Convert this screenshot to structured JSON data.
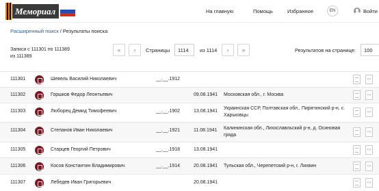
{
  "header": {
    "logo_text": "Мемориал",
    "nav": {
      "home": "На главную",
      "help": "Помощь",
      "favorites": "Избранное",
      "lang": "EN",
      "login": "Войти"
    }
  },
  "breadcrumb": {
    "advanced": "Расширенный поиск",
    "sep": "/",
    "current": "Результаты поиска"
  },
  "pager": {
    "records_line1": "Записи с 111301 по 111389",
    "records_line2": "из 111389",
    "first": "«",
    "prev": "‹",
    "next": "›",
    "last": "»",
    "pages_label": "Страницы",
    "page_value": "1114",
    "of_total": "из 1114",
    "per_page_label": "Результатов на странице:",
    "per_page_value": "100"
  },
  "row_icons": {
    "doc": "document-icon",
    "card": "card-icon",
    "code": "<>"
  },
  "rows": [
    {
      "id": "111301",
      "name": "Шевель Василий Николаевич",
      "birth": "__.__.1912",
      "date": "",
      "place": ""
    },
    {
      "id": "111302",
      "name": "Горшков Федор Леонтьевич",
      "birth": "",
      "date": "09.08.1941",
      "place": "Московская обл., г. Москва"
    },
    {
      "id": "111303",
      "name": "Люборец Демид Тимофеевич",
      "birth": "__.__.1902",
      "date": "13.08.1941",
      "place": "Украинская ССР, Полтавская обл., Пирятинский р-н, с. Харьковцы"
    },
    {
      "id": "111304",
      "name": "Степанов Иван Николаевич",
      "birth": "__.__.1921",
      "date": "11.08.1941",
      "place": "Калининская обл., Лихославльский р-н, д. Осиновая гряда"
    },
    {
      "id": "111305",
      "name": "Старцев Георгий Петрович",
      "birth": "__.__.1918",
      "date": "13.08.1941",
      "place": ""
    },
    {
      "id": "111306",
      "name": "Косов Константин Владимирович",
      "birth": "__.__.1914",
      "date": "20.08.1941",
      "place": "Тульская обл., Черепетский р-н, г. Лихвин"
    },
    {
      "id": "111307",
      "name": "Лебедев Иван Григорьевич",
      "birth": "",
      "date": "20.08.1941",
      "place": ""
    }
  ]
}
